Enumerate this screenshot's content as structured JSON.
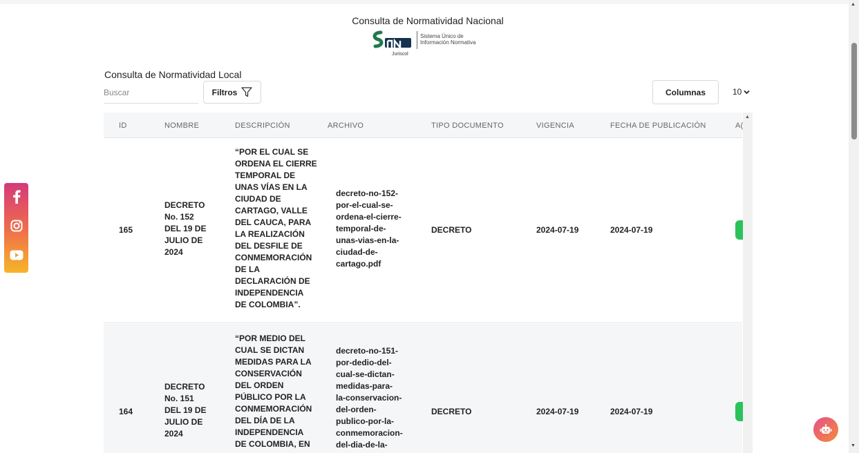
{
  "header": {
    "national_title": "Consulta de Normatividad Nacional",
    "logo_tagline_line1": "Sistema Único de",
    "logo_tagline_line2": "Información Normativa",
    "logo_sub": "Juriscol"
  },
  "local": {
    "title": "Consulta de Normatividad Local",
    "search_placeholder": "Buscar",
    "search_value": "",
    "filters_label": "Filtros",
    "columns_label": "Columnas",
    "per_page": "10"
  },
  "table": {
    "headers": {
      "id": "ID",
      "nombre": "NOMBRE",
      "descripcion": "DESCRIPCIÓN",
      "archivo": "ARCHIVO",
      "tipo": "TIPO DOCUMENTO",
      "vigencia": "VIGENCIA",
      "fecha": "FECHA DE PUBLICACIÓN",
      "acciones": "A("
    },
    "rows": [
      {
        "id": "165",
        "nombre": "DECRETO\nNo. 152\nDEL 19 DE\nJULIO DE\n2024",
        "descripcion": "“POR EL CUAL SE\nORDENA EL CIERRE\nTEMPORAL DE\nUNAS VÍAS EN LA\nCIUDAD DE\nCARTAGO, VALLE\nDEL CAUCA, PARA\nLA REALIZACIÓN\nDEL DESFILE DE\nCONMEMORACIÓN\nDE LA\nDECLARACIÓN DE\nINDEPENDENCIA\nDE COLOMBIA”.",
        "archivo": "decreto-no-152-\npor-el-cual-se-\nordena-el-cierre-\ntemporal-de-\nunas-vias-en-la-\nciudad-de-\ncartago.pdf",
        "tipo": "DECRETO",
        "vigencia": "2024-07-19",
        "fecha": "2024-07-19"
      },
      {
        "id": "164",
        "nombre": "DECRETO\nNo. 151\nDEL 19 DE\nJULIO DE\n2024",
        "descripcion": "“POR MEDIO DEL\nCUAL SE DICTAN\nMEDIDAS PARA LA\nCONSERVACIÓN\nDEL ORDEN\nPÚBLICO POR LA\nCONMEMORACIÓN\nDEL DÍA DE LA\nINDEPENDENCIA\nDE COLOMBIA, EN",
        "archivo": "decreto-no-151-\npor-dedio-del-\ncual-se-dictan-\nmedidas-para-\nla-conservacion-\ndel-orden-\npublico-por-la-\nconmemoracion-\ndel-dia-de-la-",
        "tipo": "DECRETO",
        "vigencia": "2024-07-19",
        "fecha": "2024-07-19"
      }
    ]
  },
  "icons": {
    "facebook": "facebook-icon",
    "instagram": "instagram-icon",
    "youtube": "youtube-icon",
    "filter": "filter-icon",
    "chevron": "chevron-down-icon",
    "chatbot": "robot-icon"
  },
  "colors": {
    "logo_green": "#1f7a4d",
    "logo_dark": "#15324f",
    "action_green": "#2bc25a",
    "social_top": "#d43a7a",
    "social_bottom": "#f6b52a"
  }
}
